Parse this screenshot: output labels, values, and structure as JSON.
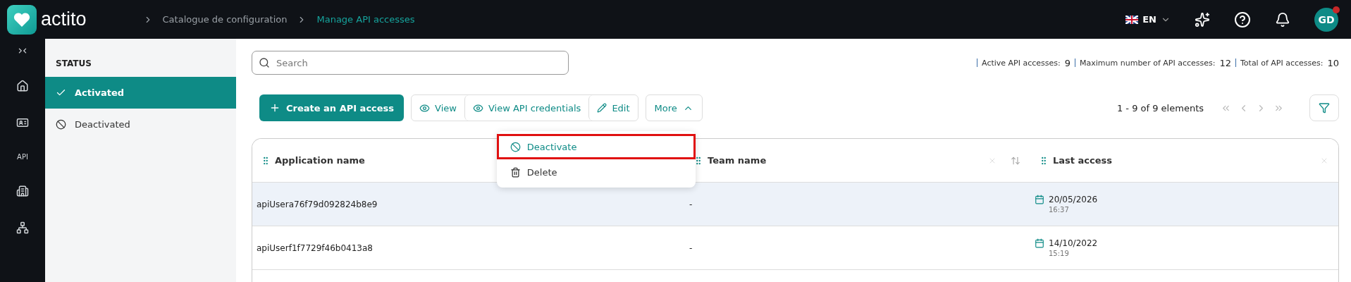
{
  "header": {
    "logo": "actito",
    "breadcrumb": [
      {
        "label": "Catalogue de configuration",
        "selected": false
      },
      {
        "label": "Manage API accesses",
        "selected": true
      }
    ],
    "language": "EN",
    "avatar": "GD",
    "notification_dot": true
  },
  "rail": [
    {
      "kind": "collapse"
    },
    {
      "kind": "home"
    },
    {
      "kind": "card"
    },
    {
      "kind": "text",
      "label": "API"
    },
    {
      "kind": "building"
    },
    {
      "kind": "org"
    }
  ],
  "sidebar": {
    "title": "STATUS",
    "items": [
      {
        "label": "Activated",
        "selected": true
      },
      {
        "label": "Deactivated",
        "selected": false
      }
    ]
  },
  "search": {
    "placeholder": "Search"
  },
  "stats": [
    {
      "label": "Active API accesses:",
      "value": "9"
    },
    {
      "label": "Maximum number of API accesses:",
      "value": "12"
    },
    {
      "label": "Total of API accesses:",
      "value": "10"
    }
  ],
  "toolbar": {
    "create": "Create an API access",
    "actions": [
      {
        "label": "View"
      },
      {
        "label": "View API credentials"
      },
      {
        "label": "Edit"
      }
    ],
    "more": "More",
    "expanded": true
  },
  "menu": [
    {
      "label": "Deactivate",
      "highlighted": true
    },
    {
      "label": "Delete",
      "highlighted": false
    }
  ],
  "pagination": "1 - 9 of 9 elements",
  "table": {
    "columns": [
      {
        "label": "Application name"
      },
      {
        "label": "Team name"
      },
      {
        "label": "Last access"
      }
    ],
    "rows": [
      {
        "name": "apiUsera76f79d092824b8e9",
        "team": "-",
        "date": "20/05/2026",
        "time": "16:37",
        "selected": true
      },
      {
        "name": "apiUserf1f7729f46b0413a8",
        "team": "-",
        "date": "14/10/2022",
        "time": "15:19",
        "selected": false
      }
    ]
  }
}
